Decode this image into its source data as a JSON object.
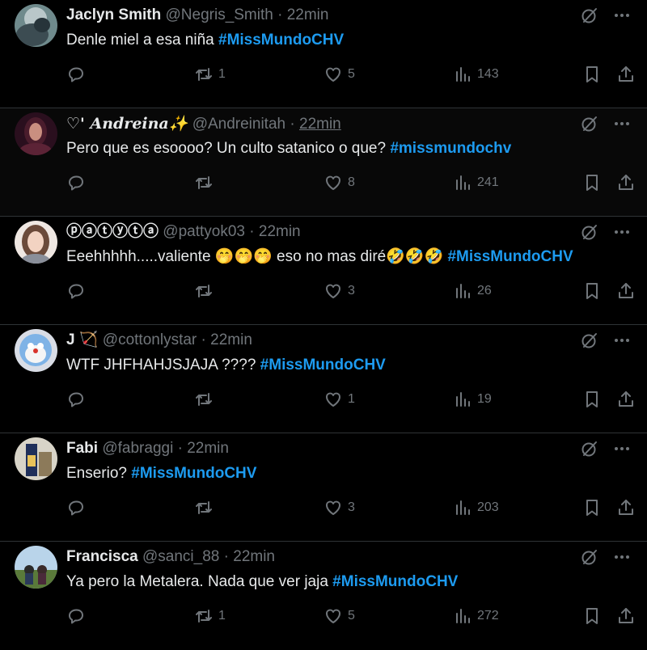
{
  "colors": {
    "background": "#000000",
    "text": "#e7e9ea",
    "muted": "#71767b",
    "hashtag": "#1d9bf0",
    "divider": "#2f3336"
  },
  "tweets": [
    {
      "name": "Jaclyn Smith",
      "handle": "@Negris_Smith",
      "dot": "·",
      "time": "22min",
      "text": "Denle miel a esa niña ",
      "hashtag": "#MissMundoCHV",
      "text_after": "",
      "reposts": "1",
      "likes": "5",
      "views": "143"
    },
    {
      "name": "♡' 𝑨𝒏𝒅𝒓𝒆𝒊𝒏𝒂✨",
      "handle": "@Andreinitah",
      "dot": "·",
      "time": "22min",
      "text": "Pero que es esoooo? Un culto satanico o que? ",
      "hashtag": "#missmundochv",
      "text_after": "",
      "reposts": "",
      "likes": "8",
      "views": "241"
    },
    {
      "name": "ⓟⓐⓣⓨⓣⓐ",
      "handle": "@pattyok03",
      "dot": "·",
      "time": "22min",
      "text": "Eeehhhhh.....valiente 🤭🤭🤭 eso no mas diré🤣🤣🤣 ",
      "hashtag": "#MissMundoCHV",
      "text_after": "",
      "reposts": "",
      "likes": "3",
      "views": "26"
    },
    {
      "name": "J 🏹",
      "handle": "@cottonlystar",
      "dot": "·",
      "time": "22min",
      "text": "WTF JHFHAHJSJAJA ???? ",
      "hashtag": "#MissMundoCHV",
      "text_after": "",
      "reposts": "",
      "likes": "1",
      "views": "19"
    },
    {
      "name": "Fabi",
      "handle": "@fabraggi",
      "dot": "·",
      "time": "22min",
      "text": "Enserio? ",
      "hashtag": "#MissMundoCHV",
      "text_after": "",
      "reposts": "",
      "likes": "3",
      "views": "203"
    },
    {
      "name": "Francisca",
      "handle": "@sanci_88",
      "dot": "·",
      "time": "22min",
      "text": "Ya pero la Metalera. Nada que ver jaja ",
      "hashtag": "#MissMundoCHV",
      "text_after": "",
      "reposts": "1",
      "likes": "5",
      "views": "272"
    }
  ]
}
